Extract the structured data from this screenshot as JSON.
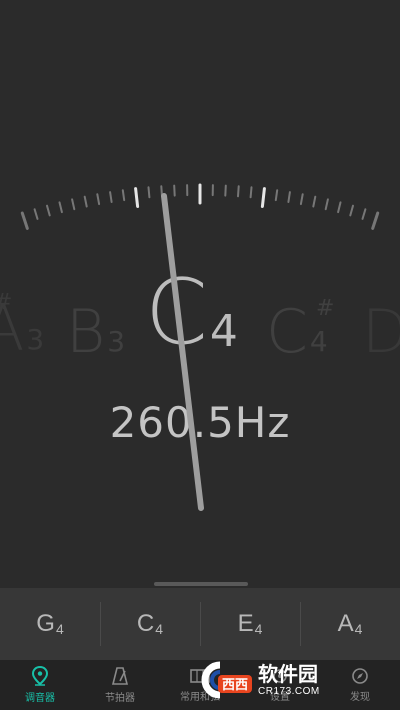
{
  "tuner": {
    "prev_note": {
      "letter": "A",
      "sharp": "#",
      "octave": "3"
    },
    "left_note": {
      "letter": "B",
      "octave": "3"
    },
    "current_note": {
      "letter": "C",
      "octave": "4"
    },
    "right_note": {
      "letter": "C",
      "sharp": "#",
      "octave": "4"
    },
    "next_note": {
      "letter": "D"
    },
    "frequency": "260.5Hz"
  },
  "strings": [
    {
      "letter": "G",
      "octave": "4"
    },
    {
      "letter": "C",
      "octave": "4"
    },
    {
      "letter": "E",
      "octave": "4"
    },
    {
      "letter": "A",
      "octave": "4"
    }
  ],
  "tabs": [
    {
      "label": "调音器",
      "icon": "location-pin-icon",
      "active": true
    },
    {
      "label": "节拍器",
      "icon": "metronome-icon",
      "active": false
    },
    {
      "label": "常用和弦",
      "icon": "chord-icon",
      "active": false
    },
    {
      "label": "设置",
      "icon": "settings-icon",
      "active": false
    },
    {
      "label": "发现",
      "icon": "discover-icon",
      "active": false
    }
  ],
  "watermark": {
    "title": "软件园",
    "url": "CR173.COM",
    "logo_text": "西西"
  },
  "colors": {
    "accent": "#18c0a8",
    "background": "#2b2b2b",
    "panel": "#373737",
    "tabbar": "#232323"
  }
}
